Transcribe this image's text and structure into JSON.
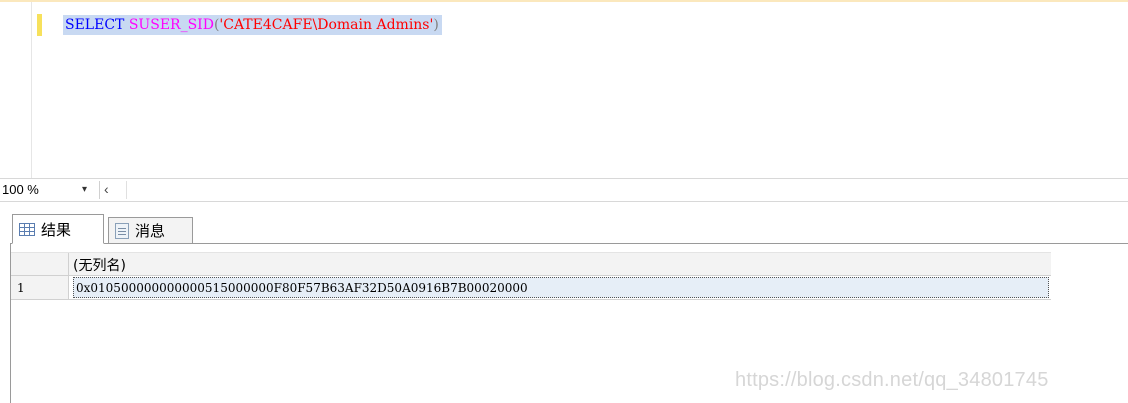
{
  "editor": {
    "tokens": {
      "keyword": "SELECT",
      "function": "SUSER_SID",
      "open_paren": "(",
      "string": "'CATE4CAFE\\Domain Admins'",
      "close_paren": ")"
    }
  },
  "zoom": {
    "value": "100 %",
    "dropdown_icon": "▾",
    "scroll_left_icon": "‹"
  },
  "tabs": [
    {
      "label": "结果",
      "icon": "grid-icon"
    },
    {
      "label": "消息",
      "icon": "message-icon"
    }
  ],
  "results": {
    "columns": [
      "(无列名)"
    ],
    "rows": [
      {
        "num": "1",
        "cells": [
          "0x010500000000000515000000F80F57B63AF32D50A0916B7B00020000"
        ]
      }
    ]
  },
  "watermark": "https://blog.csdn.net/qq_34801745",
  "colors": {
    "keyword": "#0000ff",
    "function": "#ff00ff",
    "string": "#ff0000",
    "selection": "#c8d9f2",
    "change_marker": "#f7e15c"
  }
}
